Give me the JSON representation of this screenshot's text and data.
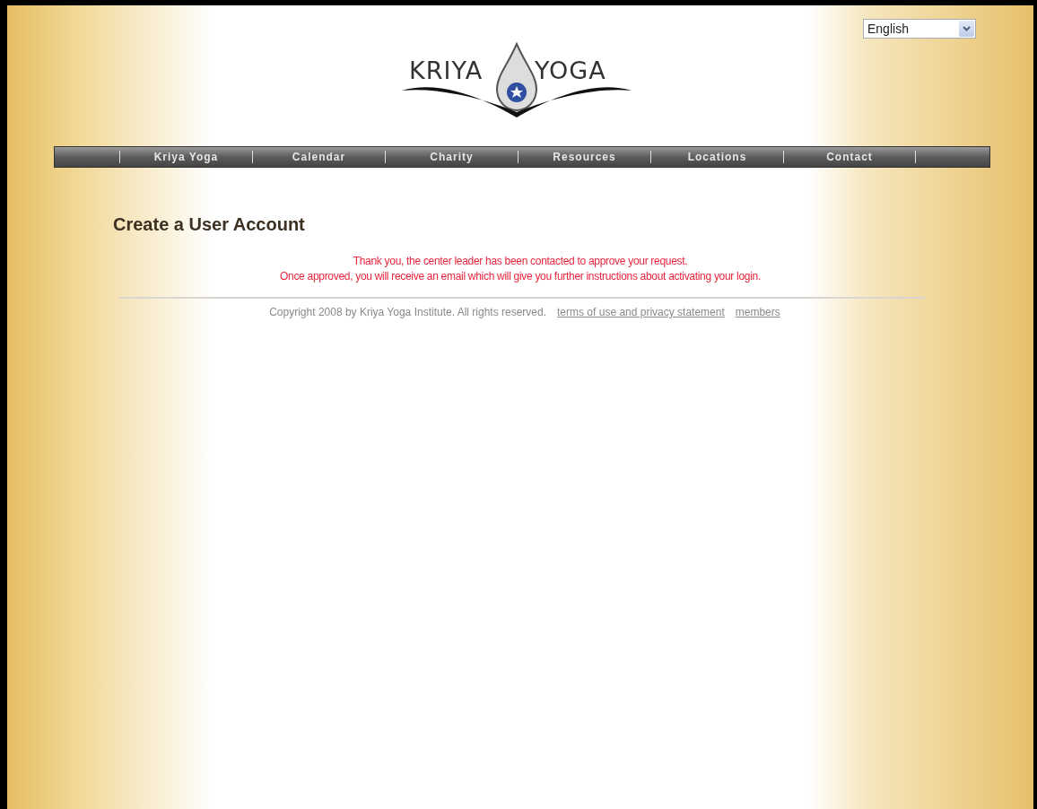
{
  "language_select": {
    "value": "English"
  },
  "logo": {
    "left_word": "KRIYA",
    "right_word": "YOGA"
  },
  "nav": [
    {
      "label": "Kriya Yoga"
    },
    {
      "label": "Calendar"
    },
    {
      "label": "Charity"
    },
    {
      "label": "Resources"
    },
    {
      "label": "Locations"
    },
    {
      "label": "Contact"
    }
  ],
  "heading": "Create a User Account",
  "messages": [
    "Thank you, the center leader has been contacted to approve your request.",
    "Once approved, you will receive an email which will give you further instructions about activating your login."
  ],
  "footer": {
    "copyright": "Copyright 2008 by Kriya Yoga Institute. All rights reserved.",
    "links": [
      "terms of use and privacy statement",
      "members"
    ]
  }
}
